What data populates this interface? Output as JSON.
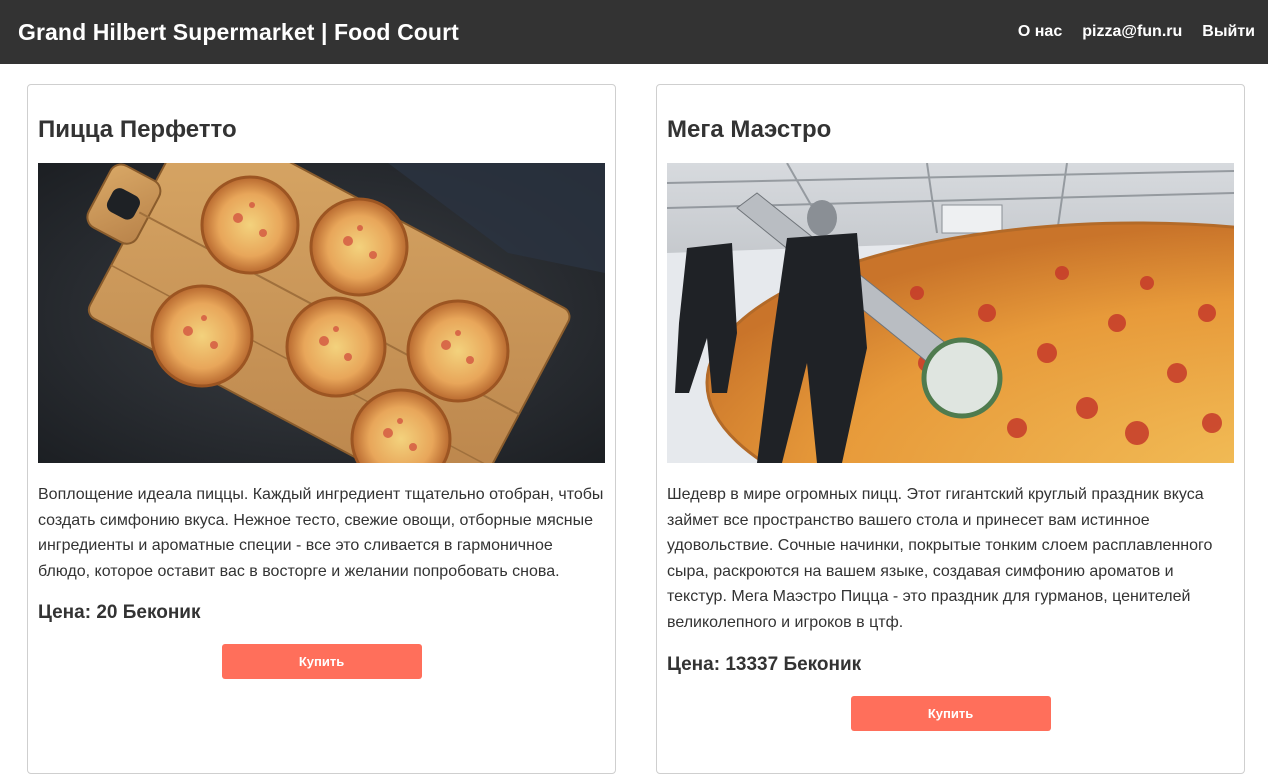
{
  "header": {
    "brand": "Grand Hilbert Supermarket | Food Court",
    "nav": {
      "about": "О нас",
      "email": "pizza@fun.ru",
      "logout": "Выйти"
    }
  },
  "products": [
    {
      "title": "Пицца Перфетто",
      "description": "Воплощение идеала пиццы. Каждый ингредиент тщательно отобран, чтобы создать симфонию вкуса. Нежное тесто, свежие овощи, отборные мясные ингредиенты и ароматные специи - все это сливается в гармоничное блюдо, которое оставит вас в восторге и желании попробовать снова.",
      "price": "Цена: 20 Беконик",
      "buy_label": "Купить",
      "image_icon": "mini-pizzas-on-board"
    },
    {
      "title": "Мега Маэстро",
      "description": "Шедевр в мире огромных пицц. Этот гигантский круглый праздник вкуса займет все пространство вашего стола и принесет вам истинное удовольствие. Сочные начинки, покрытые тонким слоем расплавленного сыра, раскроются на вашем языке, создавая симфонию ароматов и текстур. Мега Маэстро Пицца - это праздник для гурманов, ценителей великолепного и игроков в цтф.",
      "price": "Цена: 13337 Беконик",
      "buy_label": "Купить",
      "image_icon": "giant-pizza-in-hangar"
    }
  ],
  "colors": {
    "header_bg": "#333333",
    "button": "#ff6f5b",
    "text": "#333333"
  }
}
